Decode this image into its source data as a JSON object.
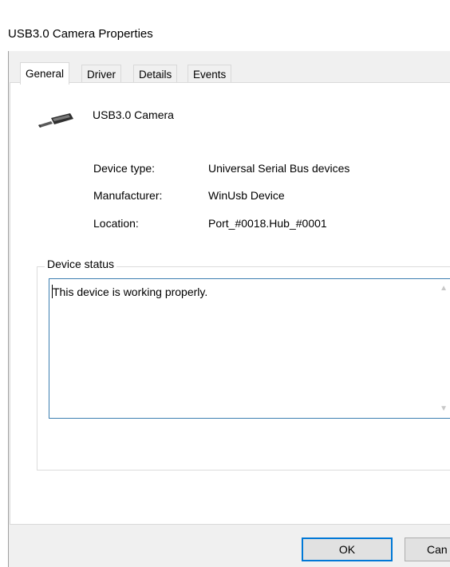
{
  "window": {
    "title": "USB3.0 Camera Properties"
  },
  "tabs": [
    {
      "label": "General",
      "active": true
    },
    {
      "label": "Driver",
      "active": false
    },
    {
      "label": "Details",
      "active": false
    },
    {
      "label": "Events",
      "active": false
    }
  ],
  "device": {
    "icon": "usb-plug-icon",
    "name": "USB3.0 Camera"
  },
  "properties": [
    {
      "label": "Device type:",
      "value": "Universal Serial Bus devices"
    },
    {
      "label": "Manufacturer:",
      "value": "WinUsb Device"
    },
    {
      "label": "Location:",
      "value": "Port_#0018.Hub_#0001"
    }
  ],
  "device_status": {
    "legend": "Device status",
    "text": "This device is working properly."
  },
  "buttons": {
    "ok_label": "OK",
    "cancel_label": "Can"
  },
  "colors": {
    "focus_border": "#0078d7",
    "status_border": "#3c7fb1"
  }
}
